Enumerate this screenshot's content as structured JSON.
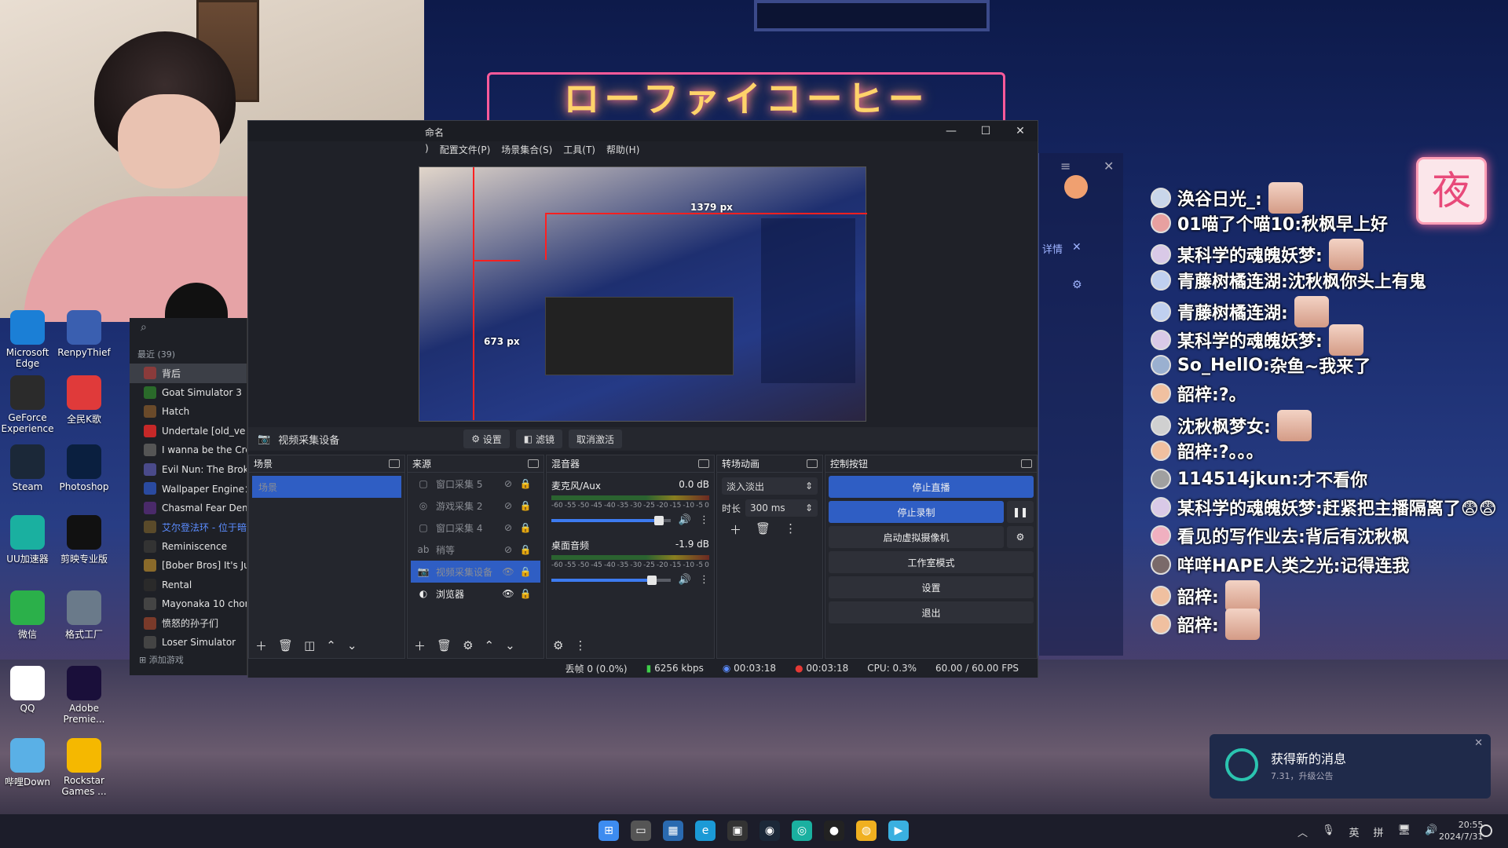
{
  "obs": {
    "title": "命名",
    "menu": [
      "配置文件(P)",
      "场景集合(S)",
      "工具(T)",
      "帮助(H)"
    ],
    "menu_partial": ")",
    "preview": {
      "width_label": "1379 px",
      "height_label": "673 px"
    },
    "source_bar": {
      "selected_source": "视频采集设备",
      "settings": "设置",
      "filters": "滤镜",
      "deactivate": "取消激活"
    },
    "scenes": {
      "title": "场景",
      "items": [
        "场景"
      ]
    },
    "sources": {
      "title": "来源",
      "items": [
        {
          "name": "窗口采集 5",
          "visible": false
        },
        {
          "name": "游戏采集 2",
          "visible": false
        },
        {
          "name": "窗口采集 4",
          "visible": false
        },
        {
          "name": "稍等",
          "visible": false
        },
        {
          "name": "视频采集设备",
          "visible": true,
          "selected": true
        },
        {
          "name": "浏览器",
          "visible": true
        }
      ]
    },
    "mixer": {
      "title": "混音器",
      "tracks": [
        {
          "name": "麦克风/Aux",
          "db": "0.0 dB",
          "level": 0.9
        },
        {
          "name": "桌面音频",
          "db": "-1.9 dB",
          "level": 0.84
        }
      ],
      "ticks": [
        "-60",
        "-55",
        "-50",
        "-45",
        "-40",
        "-35",
        "-30",
        "-25",
        "-20",
        "-15",
        "-10",
        "-5",
        "0"
      ]
    },
    "transitions": {
      "title": "转场动画",
      "type": "淡入淡出",
      "duration_label": "时长",
      "duration": "300 ms"
    },
    "controls": {
      "title": "控制按钮",
      "stop_stream": "停止直播",
      "stop_record": "停止录制",
      "virtual_cam": "启动虚拟摄像机",
      "studio_mode": "工作室模式",
      "settings": "设置",
      "exit": "退出"
    },
    "status": {
      "dropped": "丢帧 0 (0.0%)",
      "bitrate": "6256 kbps",
      "stream_time": "00:03:18",
      "rec_time": "00:03:18",
      "cpu": "CPU: 0.3%",
      "fps": "60.00 / 60.00 FPS"
    }
  },
  "game_list": {
    "header": "最近",
    "count": "(39)",
    "items": [
      "背后",
      "Goat Simulator 3",
      "Hatch",
      "Undertale [old_ve",
      "I wanna be the Cre",
      "Evil Nun: The Brok",
      "Wallpaper Engine：",
      "Chasmal Fear Dem",
      "艾尔登法环 - 位于暗",
      "Reminiscence",
      "[Bober Bros] It's Ju",
      "Rental",
      "Mayonaka 10 chor",
      "愤怒的孙子们",
      "Loser Simulator"
    ],
    "add": "添加游戏"
  },
  "desktop_icons": [
    {
      "label": "Microsoft Edge",
      "icon": "edge-icon",
      "color": "#1b7fd6"
    },
    {
      "label": "RenpyThief",
      "icon": "renpythief-icon",
      "color": "#3a5fb0"
    },
    {
      "label": "GeForce Experience",
      "icon": "geforce-icon",
      "color": "#2b2b2b"
    },
    {
      "label": "全民K歌",
      "icon": "karaoke-icon",
      "color": "#e03a3a"
    },
    {
      "label": "Steam",
      "icon": "steam-icon",
      "color": "#1b2838"
    },
    {
      "label": "Photoshop",
      "icon": "photoshop-icon",
      "color": "#0a1f3f"
    },
    {
      "label": "UU加速器",
      "icon": "uu-icon",
      "color": "#1ab0a0"
    },
    {
      "label": "剪映专业版",
      "icon": "capcut-icon",
      "color": "#111111"
    },
    {
      "label": "微信",
      "icon": "wechat-icon",
      "color": "#2bb04a"
    },
    {
      "label": "格式工厂",
      "icon": "formatfactory-icon",
      "color": "#6a7a8a"
    },
    {
      "label": "QQ",
      "icon": "qq-icon",
      "color": "#ffffff"
    },
    {
      "label": "Adobe Premie...",
      "icon": "premiere-icon",
      "color": "#1a0f3a"
    },
    {
      "label": "哔哩Down",
      "icon": "bilidown-icon",
      "color": "#5ab0e6"
    },
    {
      "label": "Rockstar Games ...",
      "icon": "rockstar-icon",
      "color": "#f5b800"
    }
  ],
  "chat": [
    {
      "user": "涣谷日光_:",
      "msg": "",
      "emote": true
    },
    {
      "user": "01喵了个喵10:",
      "msg": "秋枫早上好",
      "emote": false
    },
    {
      "user": "某科学的魂魄妖梦:",
      "msg": "",
      "emote": true
    },
    {
      "user": "青藤树橘连湖:",
      "msg": "沈秋枫你头上有鬼",
      "emote": false
    },
    {
      "user": "青藤树橘连湖:",
      "msg": "",
      "emote": true
    },
    {
      "user": "某科学的魂魄妖梦:",
      "msg": "",
      "emote": true
    },
    {
      "user": "So_HellO:",
      "msg": "杂鱼~我来了",
      "emote": false
    },
    {
      "user": "韶梓:",
      "msg": "?。",
      "emote": false
    },
    {
      "user": "沈秋枫梦女:",
      "msg": "",
      "emote": true
    },
    {
      "user": "韶梓:",
      "msg": "?。。。",
      "emote": false
    },
    {
      "user": "114514jkun:",
      "msg": "才不看你",
      "emote": false
    },
    {
      "user": "某科学的魂魄妖梦:",
      "msg": "赶紧把主播隔离了😨😨",
      "emote": false
    },
    {
      "user": "看见的写作业去:",
      "msg": "背后有沈秋枫",
      "emote": false
    },
    {
      "user": "咩咩HAPE人类之光:",
      "msg": "记得连我",
      "emote": false
    },
    {
      "user": "韶梓:",
      "msg": "",
      "emote": true
    },
    {
      "user": "韶梓:",
      "msg": "",
      "emote": true
    }
  ],
  "background": {
    "neon_sign": "ローファイコーヒー",
    "night_badge": "夜"
  },
  "side_panel": {
    "label": "详情"
  },
  "notification": {
    "title": "获得新的消息",
    "subtitle": "7.31，升级公告"
  },
  "taskbar": {
    "apps": [
      "start-icon",
      "taskview-icon",
      "store-icon",
      "edge-icon",
      "terminal-icon",
      "steam-icon",
      "uu-icon",
      "obs-icon",
      "chrome-icon",
      "bilibili-icon"
    ],
    "tray": {
      "ime1": "英",
      "ime2": "拼",
      "time": "20:55",
      "date": "2024/7/31"
    }
  },
  "colors": {
    "obs_blue": "#2f5ec4",
    "obs_bg": "#1f2128",
    "record_red": "#e53935",
    "bitrate_green": "#3ecf4a"
  }
}
